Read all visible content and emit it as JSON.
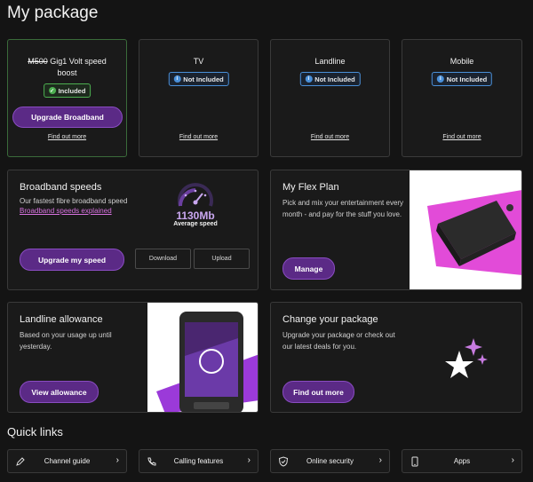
{
  "page": {
    "title": "My package"
  },
  "package_cards": [
    {
      "title_strike": "M500",
      "title_rest": " Gig1 Volt speed boost",
      "status": "Included",
      "status_icon": "check-icon",
      "action": "Upgrade Broadband",
      "link": "Find out more"
    },
    {
      "title": "TV",
      "status": "Not Included",
      "status_icon": "info-icon",
      "link": "Find out more"
    },
    {
      "title": "Landline",
      "status": "Not Included",
      "status_icon": "info-icon",
      "link": "Find out more"
    },
    {
      "title": "Mobile",
      "status": "Not Included",
      "status_icon": "info-icon",
      "link": "Find out more"
    }
  ],
  "broadband": {
    "heading": "Broadband speeds",
    "description": "Our fastest fibre broadband speed",
    "link": "Broadband speeds explained",
    "speed_value": "1130Mb",
    "speed_label": "Average speed",
    "upgrade_button": "Upgrade my speed",
    "download_tab": "Download",
    "upload_tab": "Upload"
  },
  "flex_plan": {
    "heading": "My Flex Plan",
    "description": "Pick and mix your entertainment every month - and pay for the stuff you love.",
    "button": "Manage"
  },
  "landline_allowance": {
    "heading": "Landline allowance",
    "description": "Based on your usage up until yesterday.",
    "button": "View allowance"
  },
  "change_package": {
    "heading": "Change your package",
    "description": "Upgrade your package or check out our latest deals for you.",
    "button": "Find out more"
  },
  "quick_links": {
    "title": "Quick links",
    "items": [
      {
        "label": "Channel guide",
        "icon": "pen-icon"
      },
      {
        "label": "Calling features",
        "icon": "phone-icon"
      },
      {
        "label": "Online security",
        "icon": "shield-icon"
      },
      {
        "label": "Apps",
        "icon": "smartphone-icon"
      }
    ]
  },
  "colors": {
    "accent_purple": "#5b2a86",
    "included_green": "#4caf50",
    "info_blue": "#4a90d9",
    "link_pink": "#d873e0"
  }
}
